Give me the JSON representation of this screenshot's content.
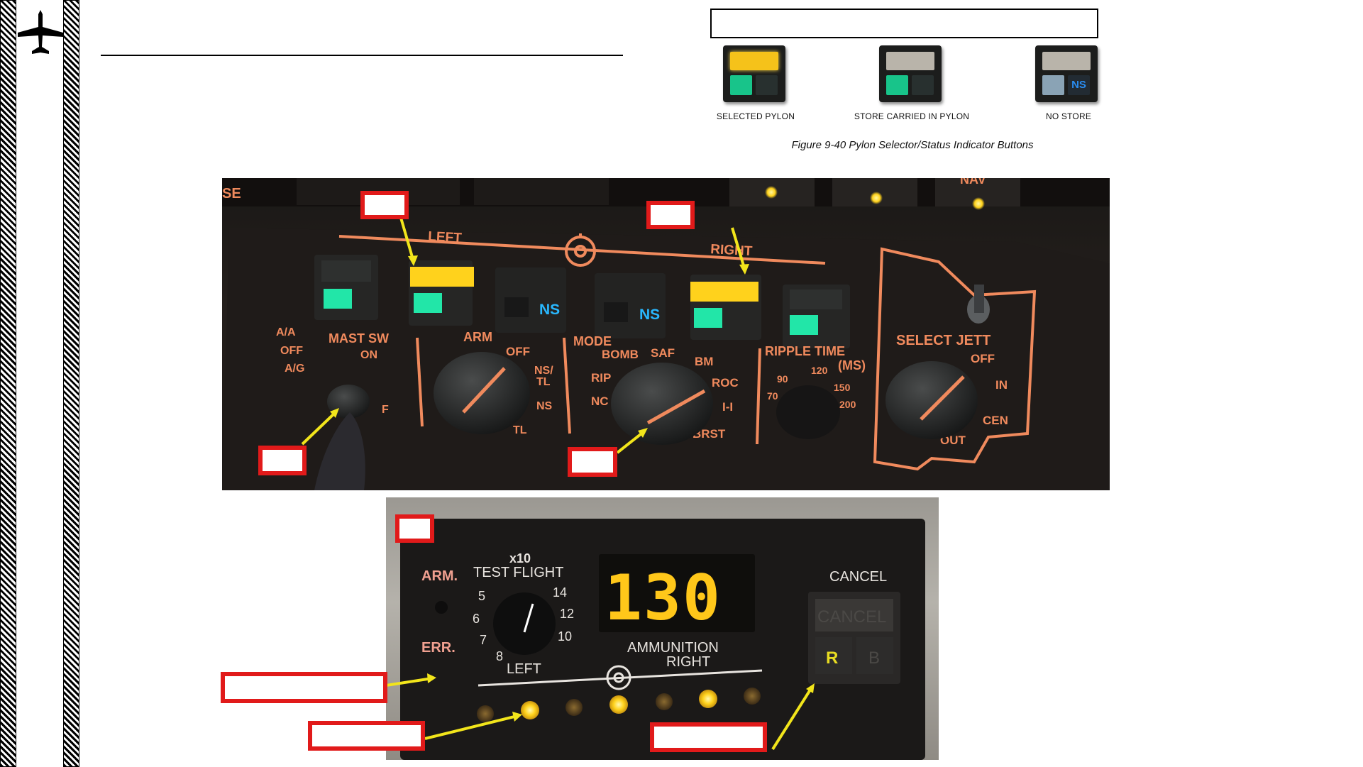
{
  "header": {
    "caption_box_text": ""
  },
  "figure": {
    "pylon_buttons": [
      {
        "label": "SELECTED PYLON",
        "top_color": "#f5c21a",
        "left_color": "#18c48a",
        "right_text": ""
      },
      {
        "label": "STORE CARRIED IN PYLON",
        "top_color": "#b9b4aa",
        "left_color": "#18c48a",
        "right_text": ""
      },
      {
        "label": "NO STORE",
        "top_color": "#b9b4aa",
        "left_color": "#8aa3b5",
        "right_text": "NS"
      }
    ],
    "caption": "Figure 9-40 Pylon Selector/Status Indicator Buttons"
  },
  "armament_panel": {
    "top_lights_label": "NAV",
    "corner_label": "SE",
    "left_label": "LEFT",
    "right_label": "RIGHT",
    "ns_label": "NS",
    "mast_sw": {
      "title": "MAST SW",
      "options": [
        "A/A",
        "OFF",
        "A/G"
      ],
      "on": "ON",
      "f": "F"
    },
    "arm": {
      "title": "ARM",
      "off": "OFF",
      "nstl": "NS/",
      "tl2": "TL",
      "ns": "NS",
      "tl": "TL"
    },
    "mode": {
      "title": "MODE",
      "bomb": "BOMB",
      "saf": "SAF",
      "bm": "BM",
      "rip": "RIP",
      "roc": "ROC",
      "nc": "NC",
      "ii": "I-I",
      "brst": "BRST"
    },
    "ripple": {
      "title": "RIPPLE TIME",
      "ms": "(MS)",
      "t90": "90",
      "t120": "120",
      "t150": "150",
      "t70": "70",
      "t200": "200"
    },
    "jett": {
      "title": "SELECT JETT",
      "off": "OFF",
      "in": "IN",
      "cen": "CEN",
      "out": "OUT"
    }
  },
  "ammo_panel": {
    "arm_label": "ARM.",
    "err_label": "ERR.",
    "x10": "x10",
    "test_flight": "TEST FLIGHT",
    "dial_numbers": [
      "5",
      "6",
      "7",
      "8",
      "14",
      "12",
      "10"
    ],
    "digits": "130",
    "ammunition": "AMMUNITION",
    "left": "LEFT",
    "right": "RIGHT",
    "cancel_title": "CANCEL",
    "cancel_button": "CANCEL",
    "r_button": "R",
    "b_button": "B"
  },
  "colors": {
    "panel_orange": "#f08a5d",
    "callout_red": "#e11a1a",
    "arrow_yellow": "#f2e51b",
    "led_yellow": "#ffd21c",
    "led_green": "#22e6a8",
    "ns_blue": "#29b8ff"
  },
  "icons": [
    "aircraft-silhouette-icon"
  ]
}
